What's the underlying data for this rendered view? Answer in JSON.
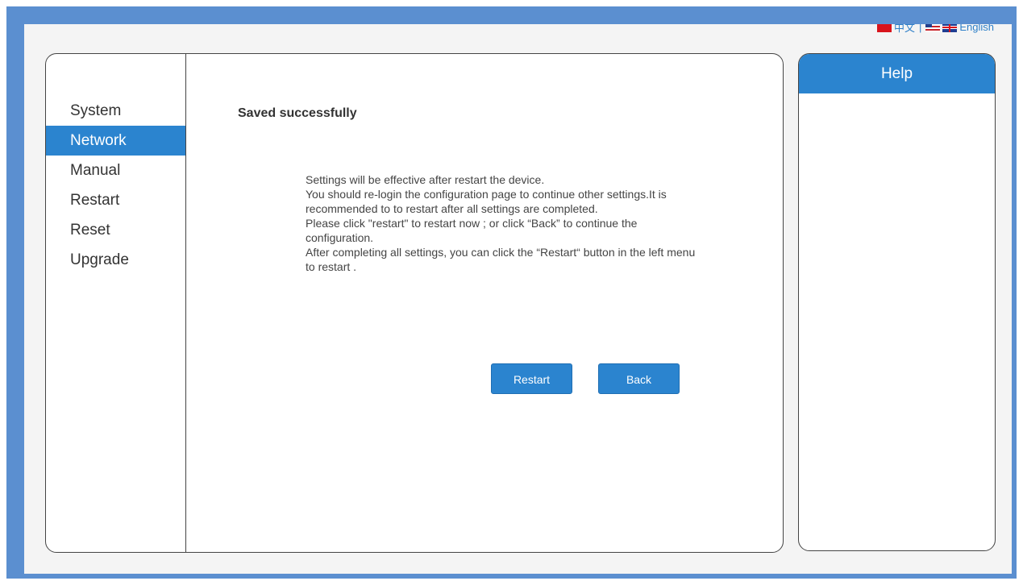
{
  "language": {
    "chinese_label": "中文",
    "separator": "|",
    "english_label": "English"
  },
  "sidebar": {
    "items": [
      {
        "label": "System"
      },
      {
        "label": "Network"
      },
      {
        "label": "Manual"
      },
      {
        "label": "Restart"
      },
      {
        "label": "Reset"
      },
      {
        "label": "Upgrade"
      }
    ],
    "active": "Network"
  },
  "content": {
    "title": "Saved successfully",
    "message_lines": [
      "Settings will be effective after restart the device.",
      "You should re-login the configuration page to continue other settings.It is recommended to to restart after all settings are completed.",
      "Please click \"restart\" to restart now ; or click “Back” to continue the configuration.",
      "After completing all settings, you can click the “Restart“ button in the left menu to restart ."
    ],
    "restart_button": "Restart",
    "back_button": "Back"
  },
  "help": {
    "title": "Help"
  },
  "colors": {
    "frame": "#5b8fd0",
    "accent": "#2b84cf",
    "background": "#f4f4f4"
  }
}
